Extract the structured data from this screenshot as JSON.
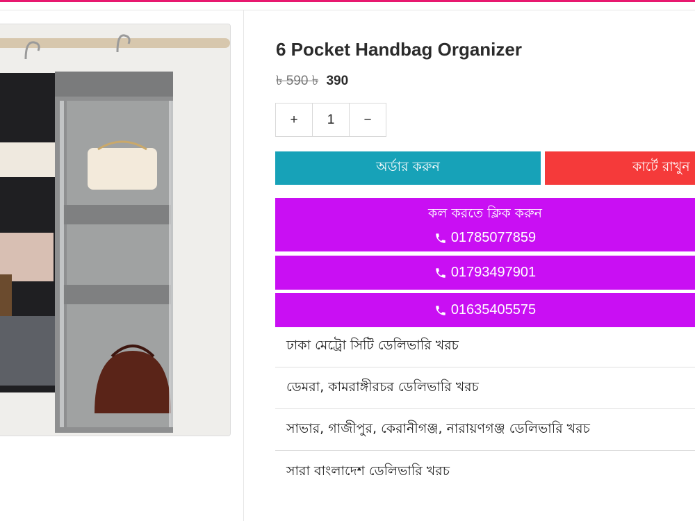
{
  "product": {
    "title": "6 Pocket Handbag Organizer",
    "old_price": "৳ 590 ৳",
    "new_price": "390",
    "image_icon": "product-photo-hanging-handbag-organizer"
  },
  "quantity": {
    "increase_label": "+",
    "value": "1",
    "decrease_label": "−"
  },
  "actions": {
    "order_label": "অর্ডার করুন",
    "cart_label": "কার্টে রাখুন"
  },
  "call": {
    "heading": "কল করতে ক্লিক করুন",
    "phones": [
      "01785077859",
      "01793497901",
      "01635405575"
    ],
    "icon": "phone-icon"
  },
  "delivery": {
    "rows": [
      "ঢাকা মেট্রো সিটি ডেলিভারি খরচ",
      "ডেমরা, কামরাঙ্গীরচর ডেলিভারি খরচ",
      "সাভার, গাজীপুর, কেরানীগঞ্জ, নারায়ণগঞ্জ ডেলিভারি খরচ",
      "সারা বাংলাদেশ ডেলিভারি খরচ"
    ]
  },
  "colors": {
    "accent_top_bar": "#e8196f",
    "order_button": "#17a2b8",
    "cart_button": "#f53a3a",
    "call_button": "#c90ff3"
  }
}
